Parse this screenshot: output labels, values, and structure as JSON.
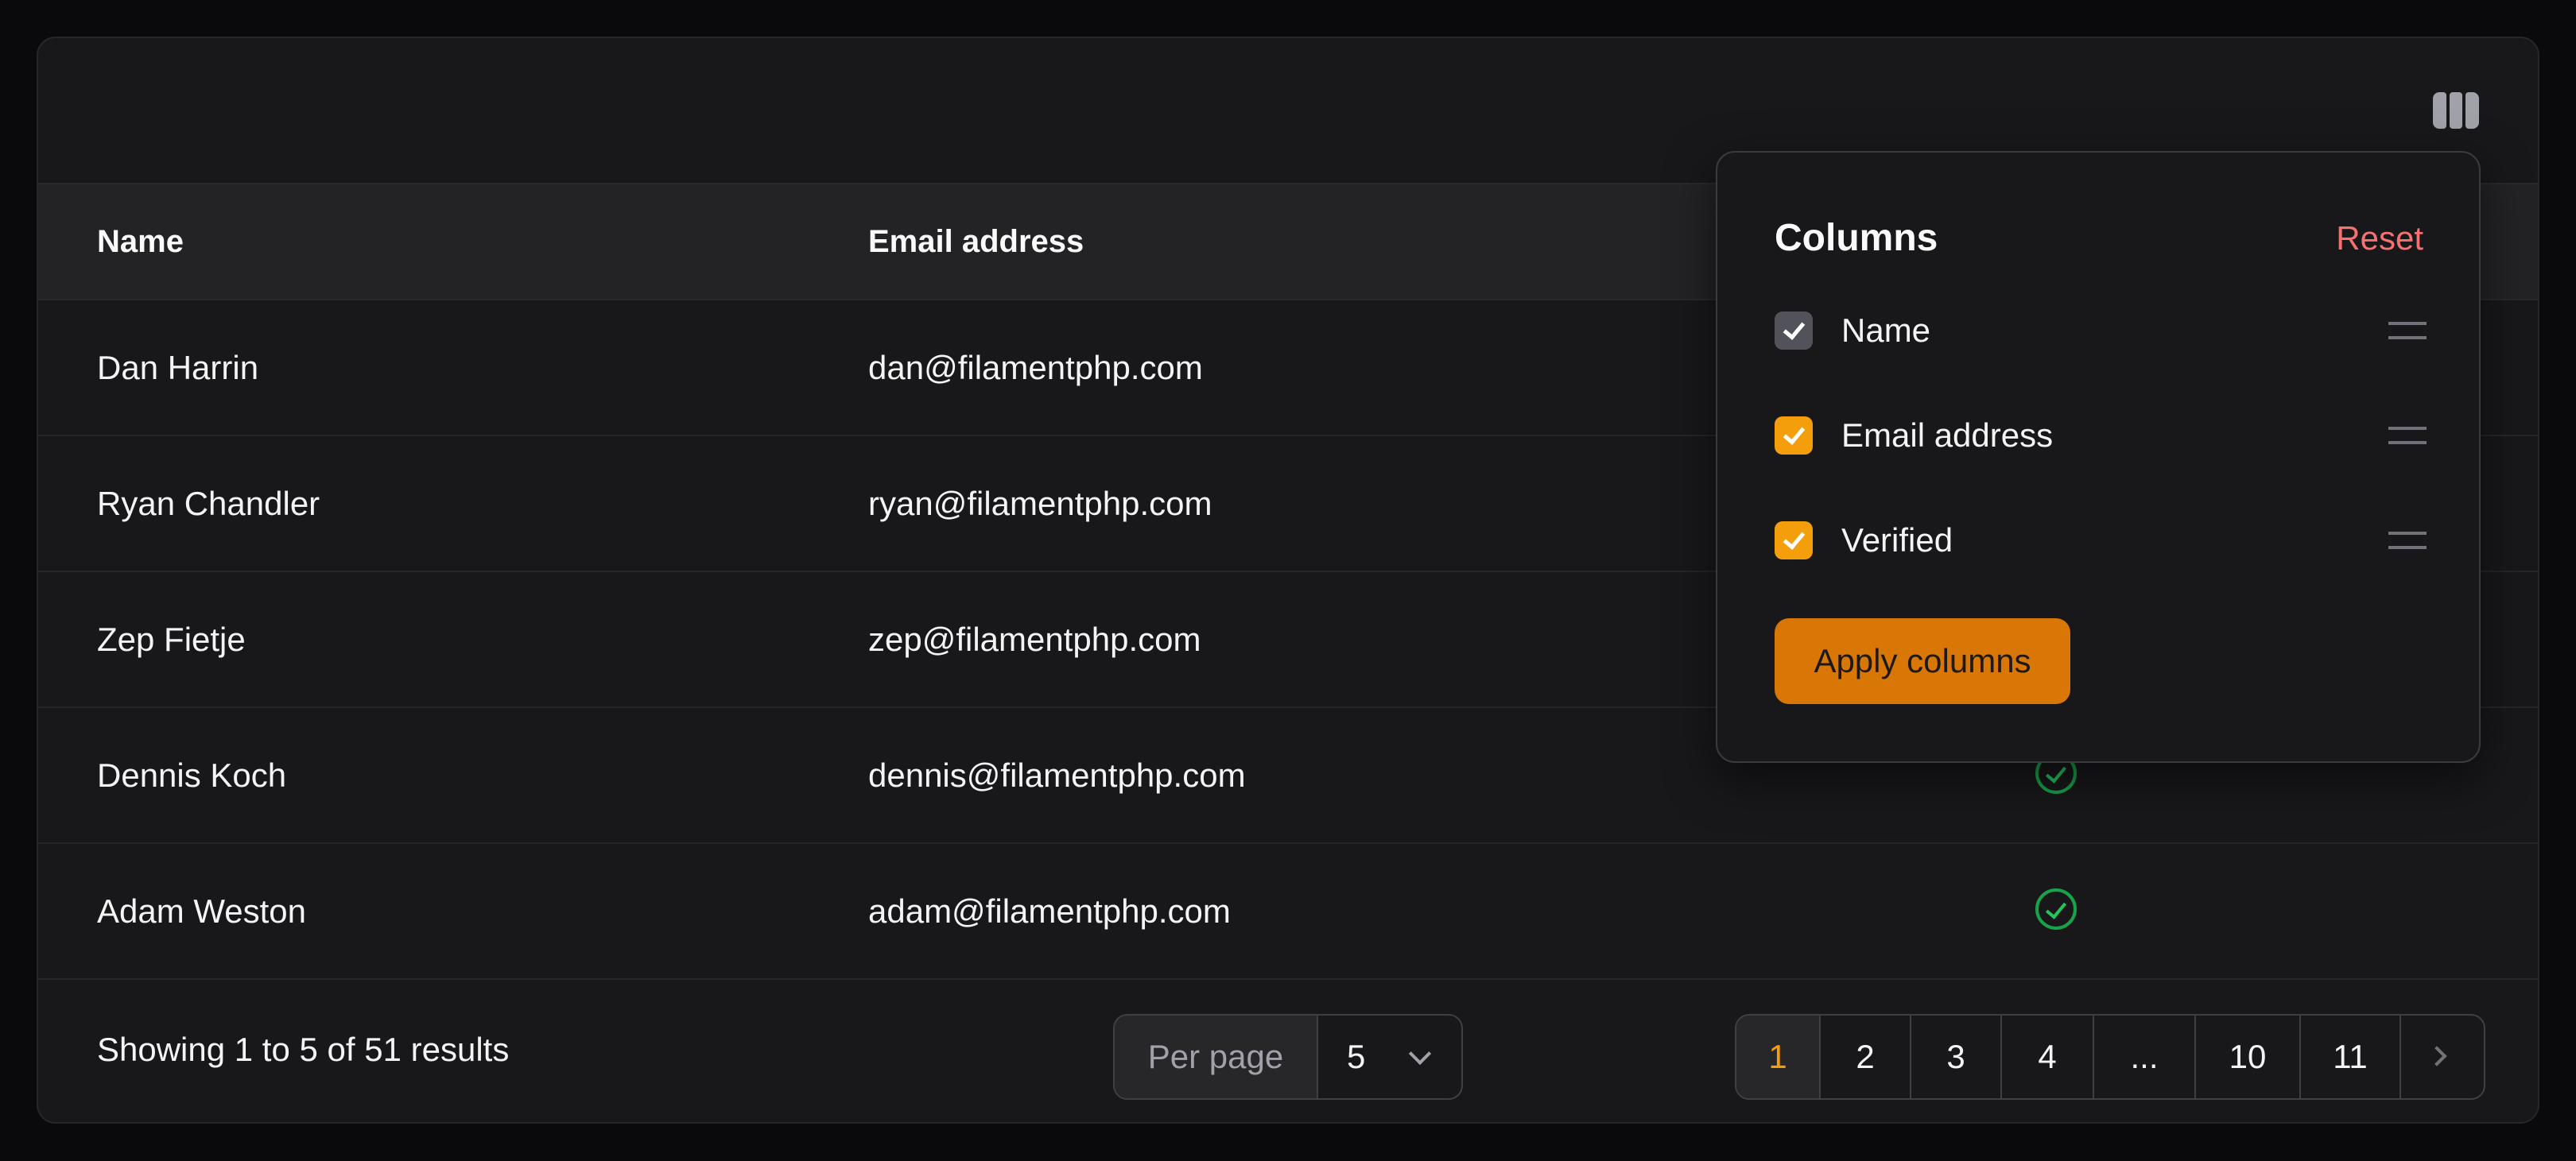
{
  "table": {
    "columns": {
      "name": "Name",
      "email": "Email address"
    },
    "rows": [
      {
        "name": "Dan Harrin",
        "email": "dan@filamentphp.com",
        "verified": true
      },
      {
        "name": "Ryan Chandler",
        "email": "ryan@filamentphp.com",
        "verified": true
      },
      {
        "name": "Zep Fietje",
        "email": "zep@filamentphp.com",
        "verified": true
      },
      {
        "name": "Dennis Koch",
        "email": "dennis@filamentphp.com",
        "verified": true
      },
      {
        "name": "Adam Weston",
        "email": "adam@filamentphp.com",
        "verified": true
      }
    ]
  },
  "column_toggle": {
    "icon": "view-columns-icon"
  },
  "columns_dropdown": {
    "title": "Columns",
    "reset_label": "Reset",
    "items": [
      {
        "label": "Name",
        "checked": true,
        "style": "gray"
      },
      {
        "label": "Email address",
        "checked": true,
        "style": "orange"
      },
      {
        "label": "Verified",
        "checked": true,
        "style": "orange"
      }
    ],
    "apply_label": "Apply columns"
  },
  "footer": {
    "showing_text": "Showing 1 to 5 of 51 results",
    "per_page_label": "Per page",
    "per_page_value": "5",
    "pages": [
      "1",
      "2",
      "3",
      "4",
      "...",
      "10",
      "11"
    ],
    "active_page": "1"
  },
  "colors": {
    "accent": "#f59e0b",
    "apply_button": "#d97706",
    "reset": "#f87171",
    "verified": "#22c55e"
  }
}
